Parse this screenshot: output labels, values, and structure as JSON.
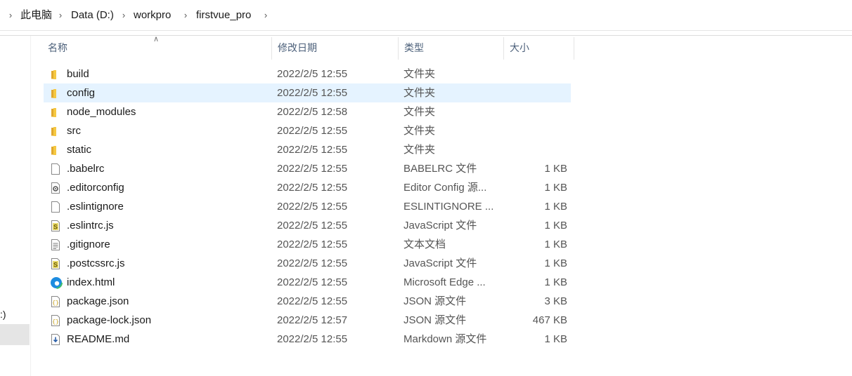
{
  "breadcrumb": {
    "items": [
      "此电脑",
      "Data (D:)",
      "workpro",
      "firstvue_pro"
    ]
  },
  "nav_pane": {
    "fragment_text": ":)"
  },
  "columns": {
    "name": "名称",
    "date": "修改日期",
    "type": "类型",
    "size": "大小"
  },
  "colors": {
    "selected_row": "#e5f3ff",
    "folder": "#f5c842",
    "header_text": "#4c607a"
  },
  "files": [
    {
      "name": "build",
      "date": "2022/2/5 12:55",
      "type": "文件夹",
      "size": "",
      "icon": "folder-icon"
    },
    {
      "name": "config",
      "date": "2022/2/5 12:55",
      "type": "文件夹",
      "size": "",
      "icon": "folder-icon",
      "selected": true
    },
    {
      "name": "node_modules",
      "date": "2022/2/5 12:58",
      "type": "文件夹",
      "size": "",
      "icon": "folder-icon"
    },
    {
      "name": "src",
      "date": "2022/2/5 12:55",
      "type": "文件夹",
      "size": "",
      "icon": "folder-icon"
    },
    {
      "name": "static",
      "date": "2022/2/5 12:55",
      "type": "文件夹",
      "size": "",
      "icon": "folder-icon"
    },
    {
      "name": ".babelrc",
      "date": "2022/2/5 12:55",
      "type": "BABELRC 文件",
      "size": "1 KB",
      "icon": "blank-file-icon"
    },
    {
      "name": ".editorconfig",
      "date": "2022/2/5 12:55",
      "type": "Editor Config 源...",
      "size": "1 KB",
      "icon": "config-file-icon"
    },
    {
      "name": ".eslintignore",
      "date": "2022/2/5 12:55",
      "type": "ESLINTIGNORE ...",
      "size": "1 KB",
      "icon": "blank-file-icon"
    },
    {
      "name": ".eslintrc.js",
      "date": "2022/2/5 12:55",
      "type": "JavaScript 文件",
      "size": "1 KB",
      "icon": "javascript-file-icon"
    },
    {
      "name": ".gitignore",
      "date": "2022/2/5 12:55",
      "type": "文本文档",
      "size": "1 KB",
      "icon": "text-file-icon"
    },
    {
      "name": ".postcssrc.js",
      "date": "2022/2/5 12:55",
      "type": "JavaScript 文件",
      "size": "1 KB",
      "icon": "javascript-file-icon"
    },
    {
      "name": "index.html",
      "date": "2022/2/5 12:55",
      "type": "Microsoft Edge ...",
      "size": "1 KB",
      "icon": "edge-html-icon"
    },
    {
      "name": "package.json",
      "date": "2022/2/5 12:55",
      "type": "JSON 源文件",
      "size": "3 KB",
      "icon": "json-file-icon"
    },
    {
      "name": "package-lock.json",
      "date": "2022/2/5 12:57",
      "type": "JSON 源文件",
      "size": "467 KB",
      "icon": "json-file-icon"
    },
    {
      "name": "README.md",
      "date": "2022/2/5 12:55",
      "type": "Markdown 源文件",
      "size": "1 KB",
      "icon": "markdown-file-icon"
    }
  ]
}
